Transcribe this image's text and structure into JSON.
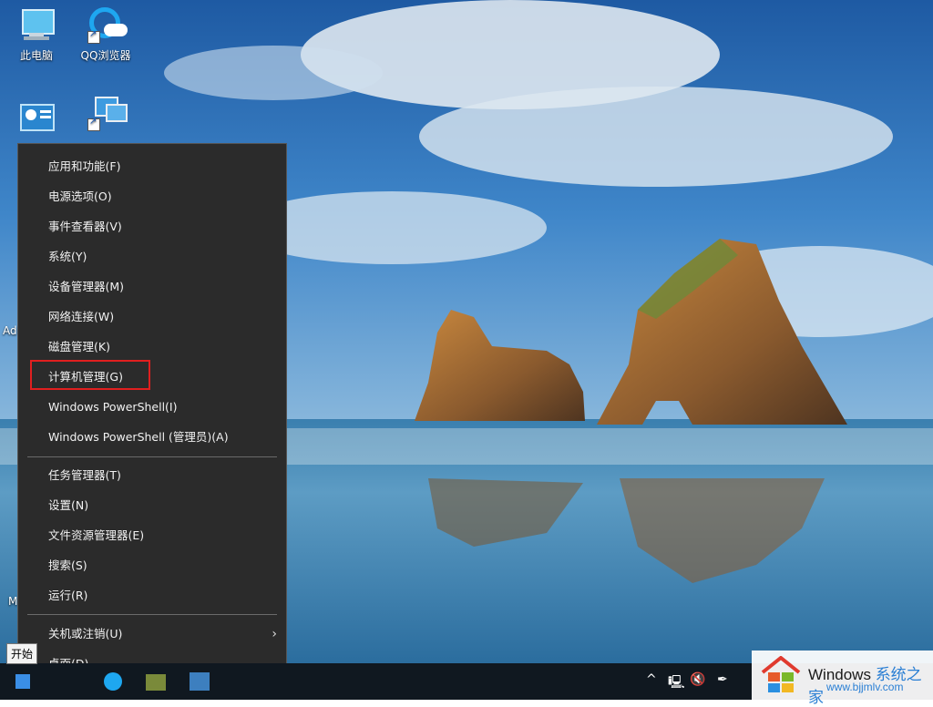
{
  "desktop": {
    "icons": [
      {
        "label": "此电脑",
        "icon": "this-pc-icon"
      },
      {
        "label": "QQ浏览器",
        "icon": "qq-browser-icon"
      },
      {
        "label": "",
        "icon": "control-panel-icon"
      },
      {
        "label": "",
        "icon": "network-icon"
      }
    ],
    "edge_fragments": [
      "Ad",
      "M"
    ]
  },
  "winx_menu": {
    "group1": [
      "应用和功能(F)",
      "电源选项(O)",
      "事件查看器(V)",
      "系统(Y)",
      "设备管理器(M)",
      "网络连接(W)",
      "磁盘管理(K)",
      "计算机管理(G)",
      "Windows PowerShell(I)",
      "Windows PowerShell (管理员)(A)"
    ],
    "group2": [
      "任务管理器(T)",
      "设置(N)",
      "文件资源管理器(E)",
      "搜索(S)",
      "运行(R)"
    ],
    "group3": [
      "关机或注销(U)",
      "桌面(D)"
    ],
    "highlighted_item": "计算机管理(G)",
    "highlight_color": "#e01f1f"
  },
  "tooltip": "开始",
  "taskbar": {
    "tray_icons": [
      "chevron-up-icon",
      "network-tray-icon",
      "volume-muted-icon",
      "pen-icon"
    ]
  },
  "watermark": {
    "title_prefix": "Windows ",
    "title_suffix": "系统之家",
    "url": "www.bjjmlv.com"
  }
}
